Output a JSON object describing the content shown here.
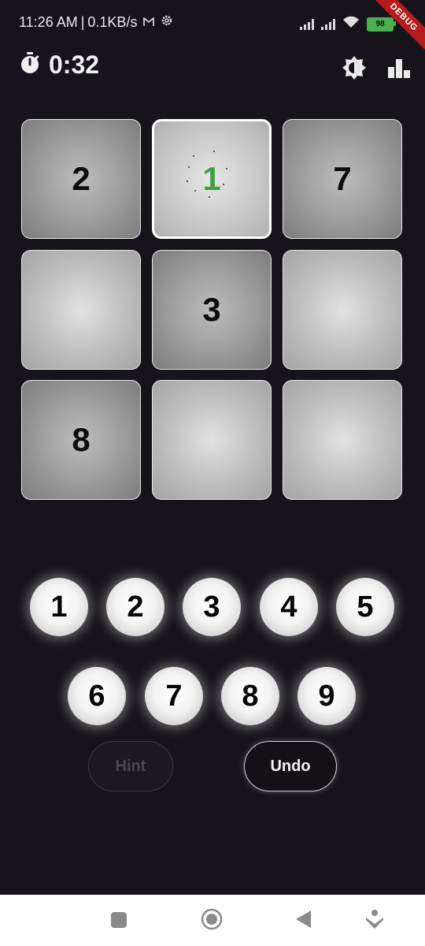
{
  "status_bar": {
    "time": "11:26 AM",
    "net_speed": "0.1KB/s",
    "battery": "98",
    "debug_label": "DEBUG"
  },
  "app_bar": {
    "timer": "0:32",
    "icons": [
      "stopwatch-icon",
      "brightness-icon",
      "leaderboard-icon"
    ]
  },
  "board": {
    "cells": [
      {
        "value": "2",
        "state": "given"
      },
      {
        "value": "1",
        "state": "selected-user"
      },
      {
        "value": "7",
        "state": "given"
      },
      {
        "value": "",
        "state": "empty"
      },
      {
        "value": "3",
        "state": "given"
      },
      {
        "value": "",
        "state": "empty"
      },
      {
        "value": "8",
        "state": "given"
      },
      {
        "value": "",
        "state": "empty"
      },
      {
        "value": "",
        "state": "empty"
      }
    ]
  },
  "numpad": {
    "keys": [
      "1",
      "2",
      "3",
      "4",
      "5",
      "6",
      "7",
      "8",
      "9"
    ]
  },
  "actions": {
    "hint_label": "Hint",
    "undo_label": "Undo"
  },
  "colors": {
    "background": "#16131a",
    "user_digit": "#43a047",
    "battery": "#4caf50",
    "debug_ribbon": "#b71c1c"
  },
  "nav_bar": {
    "icons": [
      "recents-square-icon",
      "home-circle-icon",
      "back-triangle-icon",
      "assistant-icon"
    ]
  }
}
